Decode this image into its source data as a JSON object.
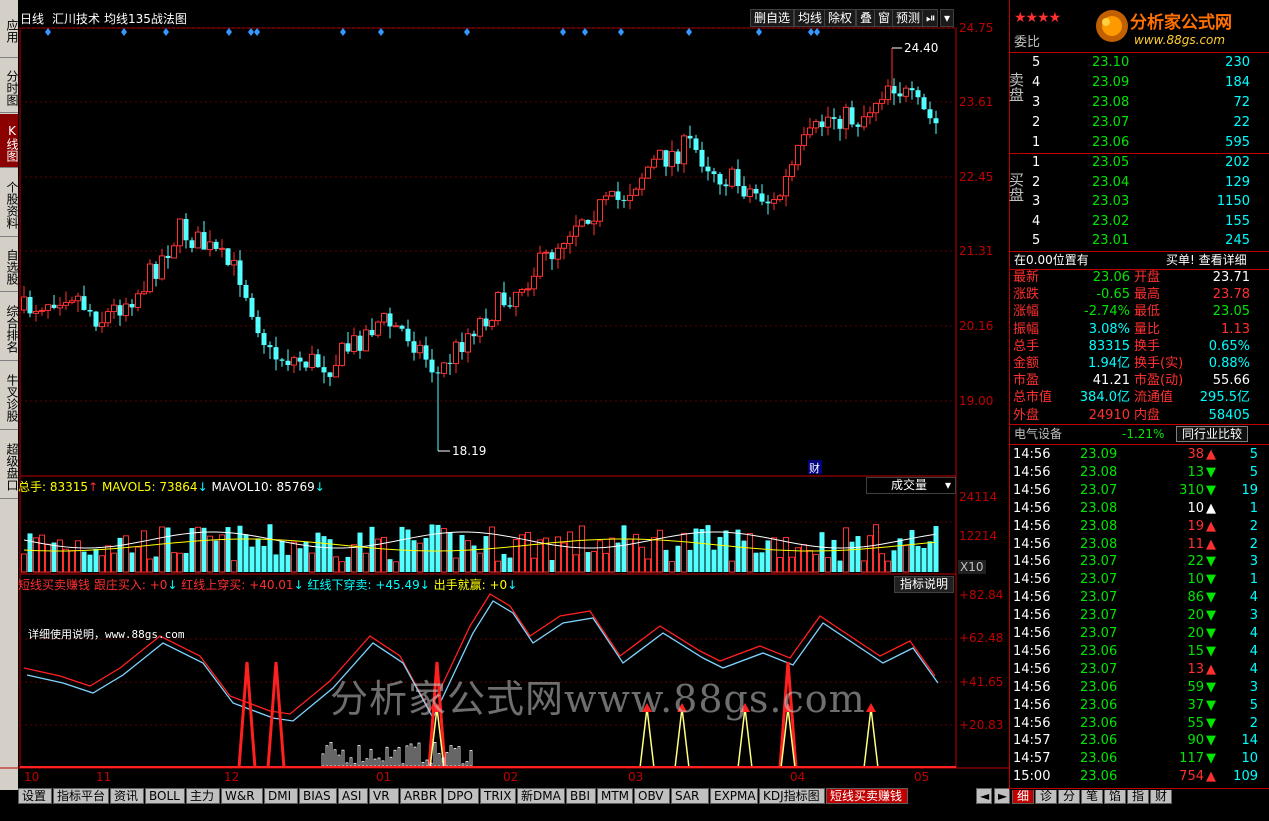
{
  "header": {
    "period": "日线",
    "stock_name": "汇川技术",
    "formula": "均线135战法图",
    "buttons": [
      "删自选",
      "均线",
      "除权",
      "叠",
      "窗",
      "预测"
    ]
  },
  "left_tabs": [
    {
      "label": "应用",
      "active": false
    },
    {
      "label": "分时图",
      "active": false
    },
    {
      "label": "K线图",
      "active": true
    },
    {
      "label": "个股资料",
      "active": false
    },
    {
      "label": "自选股",
      "active": false
    },
    {
      "label": "综合排名",
      "active": false
    },
    {
      "label": "牛叉诊股",
      "active": false
    },
    {
      "label": "超级盘口",
      "active": false
    }
  ],
  "price_axis": [
    "24.75",
    "23.61",
    "22.45",
    "21.31",
    "20.16",
    "19.00"
  ],
  "price_high_label": "24.40",
  "price_low_label": "18.19",
  "event_marker": "财",
  "volume": {
    "label": "总手:",
    "total": "83315",
    "mavol5_label": "MAVOL5:",
    "mavol5": "73864",
    "mavol10_label": "MAVOL10:",
    "mavol10": "85769",
    "selector": "成交量",
    "axis": [
      "24114",
      "12214"
    ],
    "unit": "X10"
  },
  "indicator": {
    "name": "短线买卖赚钱",
    "p1": "跟庄买入: +0",
    "p2": "红线上穿买: +40.01",
    "p3": "红线下穿卖: +45.49",
    "p4": "出手就赢: +0",
    "help_button": "指标说明",
    "axis": [
      "+82.84",
      "+62.48",
      "+41.65",
      "+20.83"
    ],
    "note": "详细使用说明，www.88gs.com"
  },
  "date_axis": [
    "10",
    "11",
    "12",
    "01",
    "02",
    "03",
    "04",
    "05"
  ],
  "watermark": "分析家公式网www.88gs.com",
  "bottom_tabs": [
    "设置",
    "指标平台",
    "资讯",
    "BOLL",
    "主力",
    "W&R",
    "DMI",
    "BIAS",
    "ASI",
    "VR",
    "ARBR",
    "DPO",
    "TRIX",
    "新DMA",
    "BBI",
    "MTM",
    "OBV",
    "SAR",
    "EXPMA",
    "KDJ指标图",
    "短线买卖赚钱"
  ],
  "active_bottom_tab": "短线买卖赚钱",
  "right_bottom_tabs": [
    "细",
    "诊",
    "分",
    "笔",
    "馅",
    "指",
    "财"
  ],
  "logo": {
    "text": "分析家公式网",
    "url": "www.88gs.com"
  },
  "order_book": {
    "weibi_label": "委比",
    "sell_label": "卖盘",
    "buy_label": "买盘",
    "sell": [
      {
        "level": "5",
        "price": "23.10",
        "vol": "230"
      },
      {
        "level": "4",
        "price": "23.09",
        "vol": "184"
      },
      {
        "level": "3",
        "price": "23.08",
        "vol": "72"
      },
      {
        "level": "2",
        "price": "23.07",
        "vol": "22"
      },
      {
        "level": "1",
        "price": "23.06",
        "vol": "595"
      }
    ],
    "buy": [
      {
        "level": "1",
        "price": "23.05",
        "vol": "202"
      },
      {
        "level": "2",
        "price": "23.04",
        "vol": "129"
      },
      {
        "level": "3",
        "price": "23.03",
        "vol": "1150"
      },
      {
        "level": "4",
        "price": "23.02",
        "vol": "155"
      },
      {
        "level": "5",
        "price": "23.01",
        "vol": "245"
      }
    ],
    "position_note": "在0.00位置有",
    "buy_note": "买单! 查看详细"
  },
  "quote": [
    {
      "l1": "最新",
      "v1": "23.06",
      "c1": "grn",
      "l2": "开盘",
      "v2": "23.71",
      "c2": "wht"
    },
    {
      "l1": "涨跌",
      "v1": "-0.65",
      "c1": "grn",
      "l2": "最高",
      "v2": "23.78",
      "c2": "red"
    },
    {
      "l1": "涨幅",
      "v1": "-2.74%",
      "c1": "grn",
      "l2": "最低",
      "v2": "23.05",
      "c2": "grn"
    },
    {
      "l1": "振幅",
      "v1": "3.08%",
      "c1": "cyan",
      "l2": "量比",
      "v2": "1.13",
      "c2": "red"
    },
    {
      "l1": "总手",
      "v1": "83315",
      "c1": "cyan",
      "l2": "换手",
      "v2": "0.65%",
      "c2": "cyan"
    },
    {
      "l1": "金额",
      "v1": "1.94亿",
      "c1": "cyan",
      "l2": "换手(实)",
      "v2": "0.88%",
      "c2": "cyan"
    },
    {
      "l1": "市盈",
      "v1": "41.21",
      "c1": "wht",
      "l2": "市盈(动)",
      "v2": "55.66",
      "c2": "wht"
    },
    {
      "l1": "总市值",
      "v1": "384.0亿",
      "c1": "cyan",
      "l2": "流通值",
      "v2": "295.5亿",
      "c2": "cyan"
    },
    {
      "l1": "外盘",
      "v1": "24910",
      "c1": "red",
      "l2": "内盘",
      "v2": "58405",
      "c2": "cyan"
    }
  ],
  "industry": {
    "name": "电气设备",
    "change": "-1.21%",
    "button": "同行业比较"
  },
  "ticks": [
    {
      "time": "14:56",
      "price": "23.09",
      "vol": "38",
      "dir": "up",
      "n": "5"
    },
    {
      "time": "14:56",
      "price": "23.08",
      "vol": "13",
      "dir": "down",
      "n": "5"
    },
    {
      "time": "14:56",
      "price": "23.07",
      "vol": "310",
      "dir": "down",
      "n": "19"
    },
    {
      "time": "14:56",
      "price": "23.08",
      "vol": "10",
      "dir": "upw",
      "n": "1"
    },
    {
      "time": "14:56",
      "price": "23.08",
      "vol": "19",
      "dir": "up",
      "n": "2"
    },
    {
      "time": "14:56",
      "price": "23.08",
      "vol": "11",
      "dir": "up",
      "n": "2"
    },
    {
      "time": "14:56",
      "price": "23.07",
      "vol": "22",
      "dir": "down",
      "n": "3"
    },
    {
      "time": "14:56",
      "price": "23.07",
      "vol": "10",
      "dir": "down",
      "n": "1"
    },
    {
      "time": "14:56",
      "price": "23.07",
      "vol": "86",
      "dir": "down",
      "n": "4"
    },
    {
      "time": "14:56",
      "price": "23.07",
      "vol": "20",
      "dir": "down",
      "n": "3"
    },
    {
      "time": "14:56",
      "price": "23.07",
      "vol": "20",
      "dir": "down",
      "n": "4"
    },
    {
      "time": "14:56",
      "price": "23.06",
      "vol": "15",
      "dir": "down",
      "n": "4"
    },
    {
      "time": "14:56",
      "price": "23.07",
      "vol": "13",
      "dir": "up",
      "n": "4"
    },
    {
      "time": "14:56",
      "price": "23.06",
      "vol": "59",
      "dir": "down",
      "n": "3"
    },
    {
      "time": "14:56",
      "price": "23.06",
      "vol": "37",
      "dir": "down",
      "n": "5"
    },
    {
      "time": "14:56",
      "price": "23.06",
      "vol": "55",
      "dir": "down",
      "n": "2"
    },
    {
      "time": "14:57",
      "price": "23.06",
      "vol": "90",
      "dir": "down",
      "n": "14"
    },
    {
      "time": "14:57",
      "price": "23.06",
      "vol": "117",
      "dir": "down",
      "n": "10"
    },
    {
      "time": "15:00",
      "price": "23.06",
      "vol": "754",
      "dir": "up",
      "n": "109"
    }
  ]
}
